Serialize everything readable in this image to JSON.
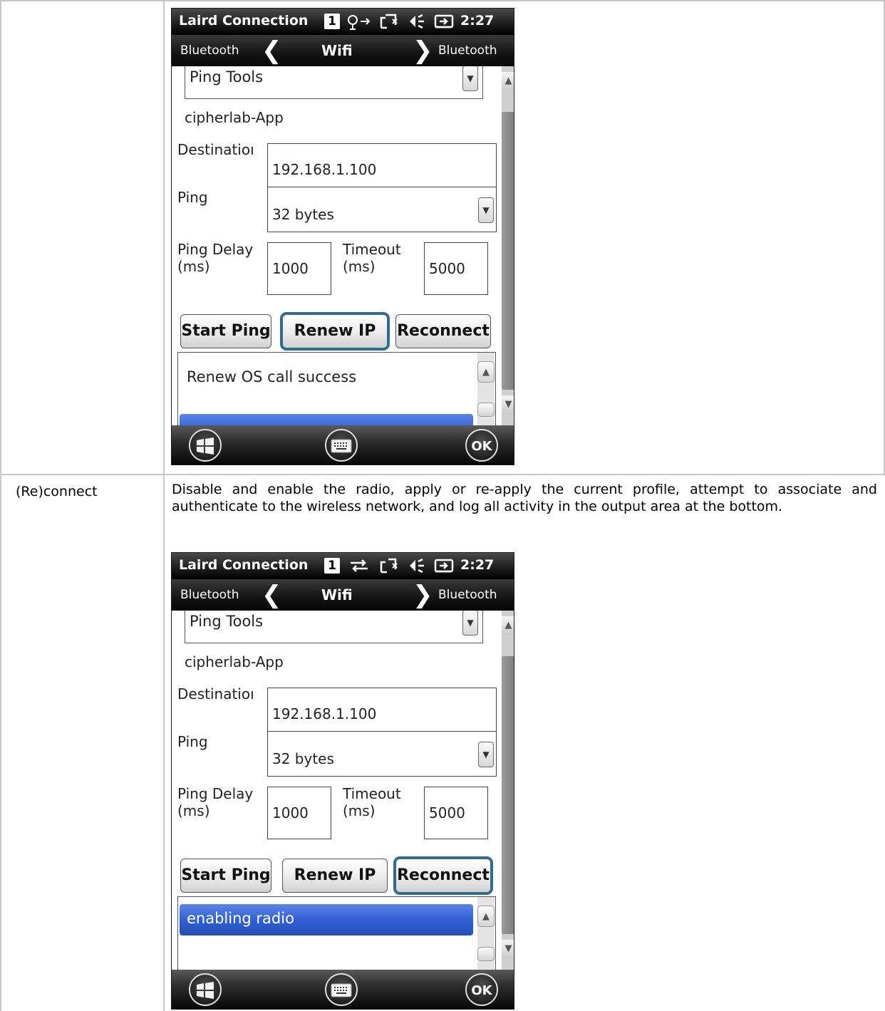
{
  "table": {
    "row_term": "(Re)connect",
    "row_description": "Disable and enable the radio, apply or re-apply the current profile, attempt to associate and authenticate to the wireless network, and log all activity in the output area at the bottom."
  },
  "screens": [
    {
      "status": {
        "app": "Laird Connection",
        "badge": "1",
        "time": "2:27"
      },
      "nav": {
        "left": "Bluetooth",
        "center": "Wifi",
        "right": "Bluetooth"
      },
      "tools_select": "Ping Tools",
      "ssid": "cipherlab-App",
      "destination_label": "Destinatioı",
      "destination_value": "192.168.1.100",
      "ping_label": "Ping",
      "ping_value": "32 bytes",
      "ping_delay_label_1": "Ping Delay",
      "ping_delay_label_2": "(ms)",
      "ping_delay_value": "1000",
      "timeout_label_1": "Timeout",
      "timeout_label_2": "(ms)",
      "timeout_value": "5000",
      "buttons": {
        "start": "Start Ping",
        "renew": "Renew IP",
        "reconnect": "Reconnect"
      },
      "log_line": "Renew OS call success",
      "ok": "OK"
    },
    {
      "status": {
        "app": "Laird Connection",
        "badge": "1",
        "time": "2:27"
      },
      "nav": {
        "left": "Bluetooth",
        "center": "Wifi",
        "right": "Bluetooth"
      },
      "tools_select": "Ping Tools",
      "ssid": "cipherlab-App",
      "destination_label": "Destinatioı",
      "destination_value": "192.168.1.100",
      "ping_label": "Ping",
      "ping_value": "32 bytes",
      "ping_delay_label_1": "Ping Delay",
      "ping_delay_label_2": "(ms)",
      "ping_delay_value": "1000",
      "timeout_label_1": "Timeout",
      "timeout_label_2": "(ms)",
      "timeout_value": "5000",
      "buttons": {
        "start": "Start Ping",
        "renew": "Renew IP",
        "reconnect": "Reconnect"
      },
      "log_line": "enabling radio",
      "ok": "OK"
    }
  ],
  "icons": [
    "windows-start-icon",
    "keyboard-icon",
    "signal-icon",
    "sync-icon",
    "volume-icon",
    "battery-icon"
  ],
  "colors": {
    "selection": "#2f5ed0",
    "focus_ring": "#2d6b8f",
    "table_border": "#c8c8c8"
  }
}
